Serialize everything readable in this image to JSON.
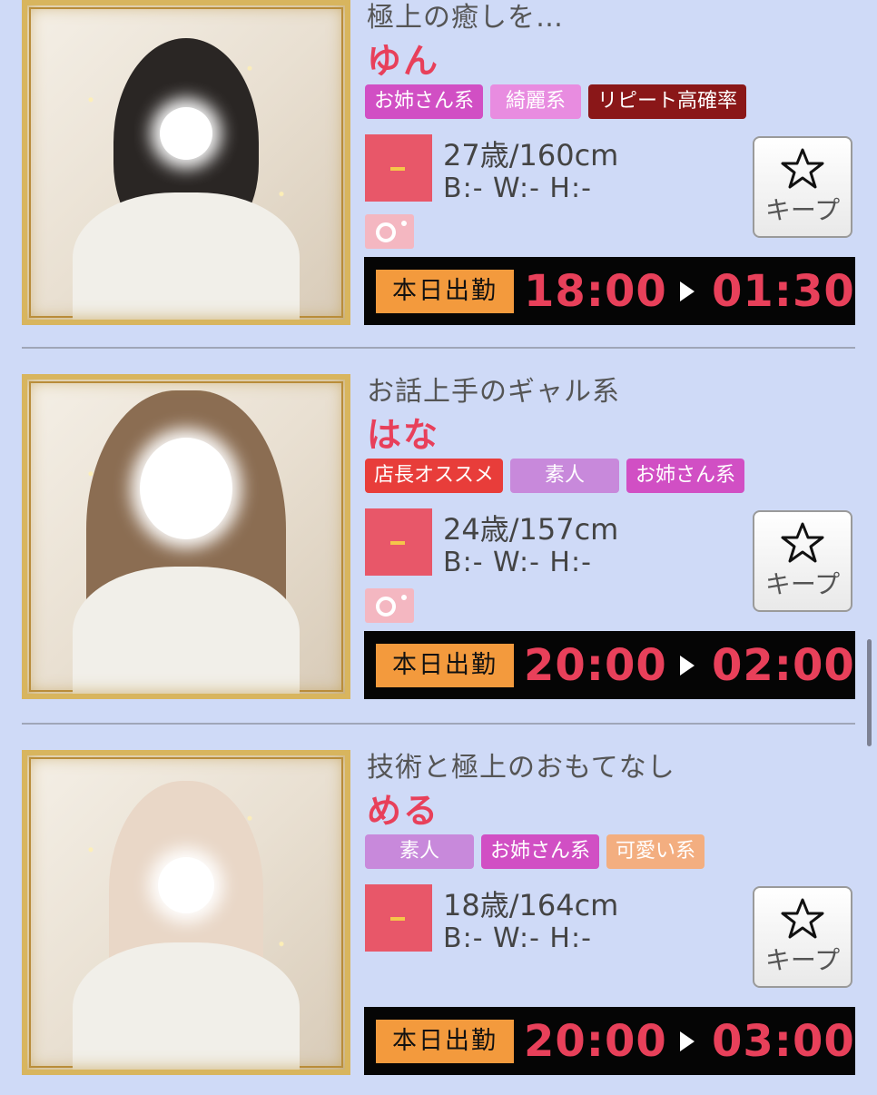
{
  "cards": [
    {
      "catchphrase": "極上の癒しを…",
      "name": "ゆん",
      "tags": [
        {
          "label": "お姉さん系",
          "color": "#d14fc4"
        },
        {
          "label": "綺麗系",
          "color": "#e88ce0"
        },
        {
          "label": "リピート高確率",
          "color": "#8a1718"
        }
      ],
      "rank": "–",
      "age_height": "27歳/160cm",
      "measurements": "B:- W:- H:-",
      "has_photo_diary": true,
      "keep_label": "キープ",
      "shift_label": "本日出勤",
      "start_time": "18:00",
      "end_time": "01:30",
      "hair_color": "#2a2624"
    },
    {
      "catchphrase": "お話上手のギャル系",
      "name": "はな",
      "tags": [
        {
          "label": "店長オススメ",
          "color": "#e83d3a"
        },
        {
          "label": "素人",
          "color": "#c889db"
        },
        {
          "label": "お姉さん系",
          "color": "#d14fc4"
        }
      ],
      "rank": "–",
      "age_height": "24歳/157cm",
      "measurements": "B:- W:- H:-",
      "has_photo_diary": true,
      "keep_label": "キープ",
      "shift_label": "本日出勤",
      "start_time": "20:00",
      "end_time": "02:00",
      "hair_color": "#8b6d52"
    },
    {
      "catchphrase": "技術と極上のおもてなし",
      "name": "める",
      "tags": [
        {
          "label": "素人",
          "color": "#c889db"
        },
        {
          "label": "お姉さん系",
          "color": "#d14fc4"
        },
        {
          "label": "可愛い系",
          "color": "#f3ae80"
        }
      ],
      "rank": "–",
      "age_height": "18歳/164cm",
      "measurements": "B:- W:- H:-",
      "has_photo_diary": false,
      "keep_label": "キープ",
      "shift_label": "本日出勤",
      "start_time": "20:00",
      "end_time": "03:00",
      "hair_color": "#e9d7c7"
    }
  ]
}
